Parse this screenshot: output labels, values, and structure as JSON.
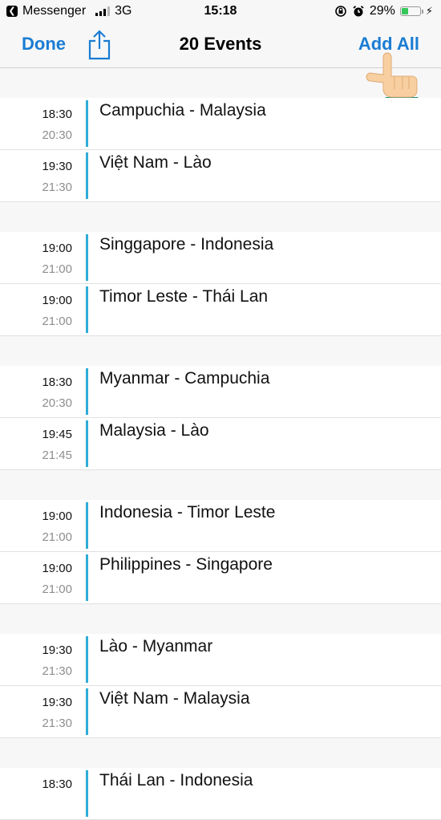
{
  "status": {
    "back_app": "Messenger",
    "network": "3G",
    "time": "15:18",
    "battery": "29%"
  },
  "nav": {
    "done": "Done",
    "title": "20 Events",
    "add_all": "Add All"
  },
  "colors": {
    "accent": "#1a7cd4",
    "calendar_bar": "#2eacd6",
    "battery": "#34c759"
  },
  "groups": [
    {
      "events": [
        {
          "start": "18:30",
          "end": "20:30",
          "title": "Campuchia - Malaysia"
        },
        {
          "start": "19:30",
          "end": "21:30",
          "title": "Việt Nam - Lào"
        }
      ]
    },
    {
      "events": [
        {
          "start": "19:00",
          "end": "21:00",
          "title": "Singgapore - Indonesia"
        },
        {
          "start": "19:00",
          "end": "21:00",
          "title": "Timor Leste - Thái Lan"
        }
      ]
    },
    {
      "events": [
        {
          "start": "18:30",
          "end": "20:30",
          "title": "Myanmar - Campuchia"
        },
        {
          "start": "19:45",
          "end": "21:45",
          "title": "Malaysia - Lào"
        }
      ]
    },
    {
      "events": [
        {
          "start": "19:00",
          "end": "21:00",
          "title": "Indonesia - Timor Leste"
        },
        {
          "start": "19:00",
          "end": "21:00",
          "title": "Philippines - Singapore"
        }
      ]
    },
    {
      "events": [
        {
          "start": "19:30",
          "end": "21:30",
          "title": "Lào - Myanmar"
        },
        {
          "start": "19:30",
          "end": "21:30",
          "title": "Việt Nam - Malaysia"
        }
      ]
    },
    {
      "events": [
        {
          "start": "18:30",
          "end": "",
          "title": "Thái Lan - Indonesia"
        }
      ]
    }
  ]
}
